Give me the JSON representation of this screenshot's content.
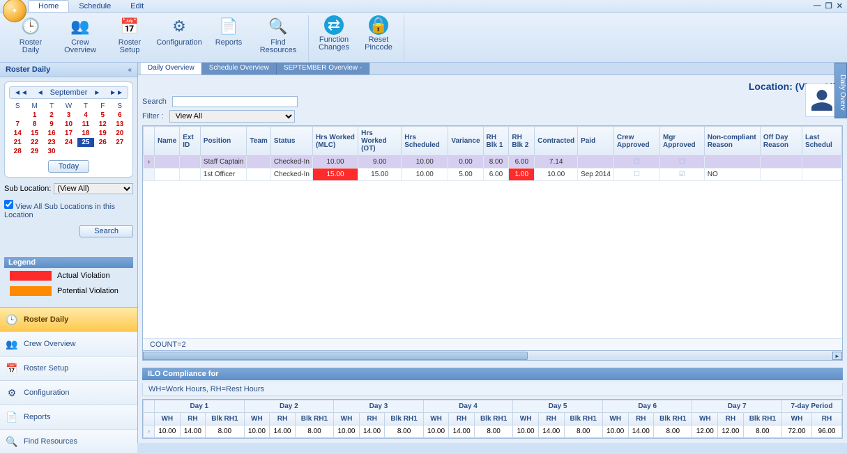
{
  "tabs": {
    "home": "Home",
    "schedule": "Schedule",
    "edit": "Edit"
  },
  "ribbon": {
    "roster_daily": "Roster\nDaily",
    "crew_overview": "Crew Overview",
    "roster_setup": "Roster\nSetup",
    "configuration": "Configuration",
    "reports": "Reports",
    "find_resources": "Find Resources",
    "function_changes": "Function\nChanges",
    "reset_pincode": "Reset\nPincode"
  },
  "sidebar": {
    "title": "Roster Daily",
    "month": "September",
    "dow": [
      "S",
      "M",
      "T",
      "W",
      "T",
      "F",
      "S"
    ],
    "days": [
      [
        "",
        "1",
        "2",
        "3",
        "4",
        "5",
        "6"
      ],
      [
        "7",
        "8",
        "9",
        "10",
        "11",
        "12",
        "13"
      ],
      [
        "14",
        "15",
        "16",
        "17",
        "18",
        "19",
        "20"
      ],
      [
        "21",
        "22",
        "23",
        "24",
        "25",
        "26",
        "27"
      ],
      [
        "28",
        "29",
        "30",
        "",
        "",
        "",
        ""
      ]
    ],
    "selected_day": "25",
    "today": "Today",
    "sub_location_label": "Sub Location:",
    "sub_location_value": "(View All)",
    "view_all_sub": "View All Sub Locations in this Location",
    "search": "Search",
    "legend_title": "Legend",
    "legend_actual": "Actual Violation",
    "legend_potential": "Potential Violation",
    "nav": [
      {
        "label": "Roster Daily",
        "active": true,
        "icon": "🕒"
      },
      {
        "label": "Crew Overview",
        "active": false,
        "icon": "👥"
      },
      {
        "label": "Roster Setup",
        "active": false,
        "icon": "📅"
      },
      {
        "label": "Configuration",
        "active": false,
        "icon": "⚙"
      },
      {
        "label": "Reports",
        "active": false,
        "icon": "📄"
      },
      {
        "label": "Find Resources",
        "active": false,
        "icon": "🔍"
      }
    ]
  },
  "content": {
    "tabs": [
      "Daily Overview",
      "Schedule Overview",
      "SEPTEMBER Overview -"
    ],
    "active_tab": 0,
    "location": "Location: (View All)",
    "search_label": "Search",
    "filter_label": "Filter :",
    "filter_value": "View All"
  },
  "grid": {
    "cols": [
      "Name",
      "Ext ID",
      "Position",
      "Team",
      "Status",
      "Hrs Worked (MLC)",
      "Hrs Worked (OT)",
      "Hrs Scheduled",
      "Variance",
      "RH Blk 1",
      "RH Blk 2",
      "Contracted",
      "Paid",
      "Crew Approved",
      "Mgr Approved",
      "Non-compliant Reason",
      "Off Day Reason",
      "Last Schedul"
    ],
    "rows": [
      {
        "sel": true,
        "name": "",
        "ext": "",
        "pos": "Staff Captain",
        "team": "",
        "status": "Checked-In",
        "mlc": "10.00",
        "ot": "9.00",
        "sched": "10.00",
        "var": "0.00",
        "rh1": "8.00",
        "rh2": "6.00",
        "contracted": "7.14",
        "paid": "",
        "crew": "☐",
        "mgr": "☐",
        "reason": "",
        "offday": "",
        "last": "",
        "viol": {
          "mlc": false,
          "rh2": false
        }
      },
      {
        "sel": false,
        "name": "",
        "ext": "",
        "pos": "1st Officer",
        "team": "",
        "status": "Checked-In",
        "mlc": "15.00",
        "ot": "15.00",
        "sched": "10.00",
        "var": "5.00",
        "rh1": "6.00",
        "rh2": "1.00",
        "contracted": "10.00",
        "paid": "Sep 2014",
        "crew": "☐",
        "mgr": "☑",
        "reason": "NO",
        "offday": "",
        "last": "",
        "viol": {
          "mlc": true,
          "rh2": true
        }
      }
    ],
    "count": "COUNT=2"
  },
  "ilo": {
    "title": "ILO Compliance for",
    "legend": "WH=Work Hours, RH=Rest Hours",
    "period": "7-day Period",
    "days": [
      "Day 1",
      "Day 2",
      "Day 3",
      "Day 4",
      "Day 5",
      "Day 6",
      "Day 7"
    ],
    "sub": [
      "WH",
      "RH",
      "Blk RH1"
    ],
    "period_sub": [
      "WH",
      "RH"
    ],
    "rows": [
      [
        "10.00",
        "14.00",
        "8.00",
        "10.00",
        "14.00",
        "8.00",
        "10.00",
        "14.00",
        "8.00",
        "10.00",
        "14.00",
        "8.00",
        "10.00",
        "14.00",
        "8.00",
        "10.00",
        "14.00",
        "8.00",
        "12.00",
        "12.00",
        "8.00",
        "72.00",
        "96.00"
      ]
    ]
  },
  "vtab": "Daily Overv"
}
